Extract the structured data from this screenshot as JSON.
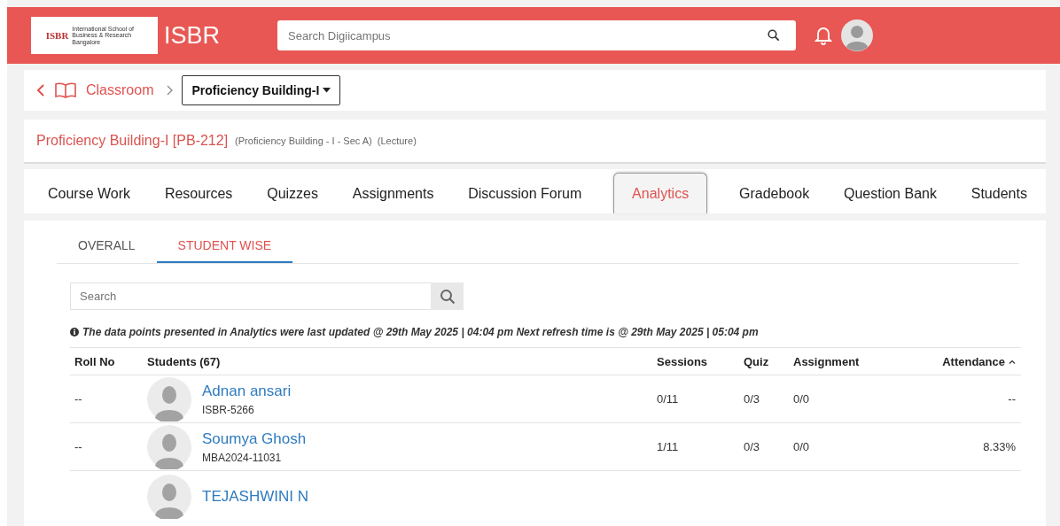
{
  "header": {
    "logo": {
      "mark": "ISBR",
      "caption": "International School of Business & Research Bangalore"
    },
    "brand": "ISBR",
    "search": {
      "placeholder": "Search Digiicampus"
    }
  },
  "breadcrumb": {
    "parent": "Classroom",
    "current": "Proficiency Building-I"
  },
  "course": {
    "title": "Proficiency Building-I [PB-212]",
    "section": "(Proficiency Building - I - Sec A)",
    "type": "(Lecture)"
  },
  "tabs": [
    {
      "label": "Course Work",
      "selected": false
    },
    {
      "label": "Resources",
      "selected": false
    },
    {
      "label": "Quizzes",
      "selected": false
    },
    {
      "label": "Assignments",
      "selected": false
    },
    {
      "label": "Discussion Forum",
      "selected": false
    },
    {
      "label": "Analytics",
      "selected": true
    },
    {
      "label": "Gradebook",
      "selected": false
    },
    {
      "label": "Question Bank",
      "selected": false
    },
    {
      "label": "Students",
      "selected": false
    }
  ],
  "subtabs": [
    {
      "label": "OVERALL",
      "selected": false
    },
    {
      "label": "STUDENT WISE",
      "selected": true
    }
  ],
  "search": {
    "placeholder": "Search"
  },
  "notice": "The data points presented in Analytics were last updated @ 29th May 2025 | 04:04 pm Next refresh time is @ 29th May 2025 | 05:04 pm",
  "table": {
    "columns": [
      "Roll No",
      "Students (67)",
      "Sessions",
      "Quiz",
      "Assignment",
      "Attendance"
    ],
    "rows": [
      {
        "roll": "--",
        "name": "Adnan ansari",
        "id": "ISBR-5266",
        "sessions": "0/11",
        "quiz": "0/3",
        "assignment": "0/0",
        "attendance": "--"
      },
      {
        "roll": "--",
        "name": "Soumya Ghosh",
        "id": "MBA2024-11031",
        "sessions": "1/11",
        "quiz": "0/3",
        "assignment": "0/0",
        "attendance": "8.33%"
      },
      {
        "name": "TEJASHWINI N"
      }
    ]
  }
}
